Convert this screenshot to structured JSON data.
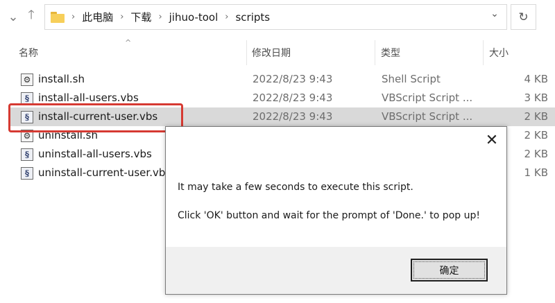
{
  "breadcrumb": [
    "此电脑",
    "下载",
    "jihuo-tool",
    "scripts"
  ],
  "columns": {
    "name": "名称",
    "date": "修改日期",
    "type": "类型",
    "size": "大小"
  },
  "files": [
    {
      "name": "install.sh",
      "date": "2022/8/23 9:43",
      "type": "Shell Script",
      "size": "4 KB",
      "icon": "shell-script-icon"
    },
    {
      "name": "install-all-users.vbs",
      "date": "2022/8/23 9:43",
      "type": "VBScript Script ...",
      "size": "3 KB",
      "icon": "vbscript-icon"
    },
    {
      "name": "install-current-user.vbs",
      "date": "2022/8/23 9:43",
      "type": "VBScript Script ...",
      "size": "2 KB",
      "icon": "vbscript-icon",
      "selected": true
    },
    {
      "name": "uninstall.sh",
      "date": "",
      "type": "",
      "size": "2 KB",
      "icon": "shell-script-icon"
    },
    {
      "name": "uninstall-all-users.vbs",
      "date": "",
      "type": "",
      "size": "2 KB",
      "icon": "vbscript-icon"
    },
    {
      "name": "uninstall-current-user.vbs",
      "date": "",
      "type": "",
      "size": "1 KB",
      "icon": "vbscript-icon"
    }
  ],
  "dialog": {
    "message_line1": "It may take a few seconds to execute this script.",
    "message_line2": "Click 'OK' button and wait for the prompt of 'Done.' to pop up!",
    "ok_label": "确定"
  },
  "colors": {
    "highlight_border": "#d63a32",
    "selected_row": "#d9d9d9",
    "folder": "#f7cf5a"
  }
}
